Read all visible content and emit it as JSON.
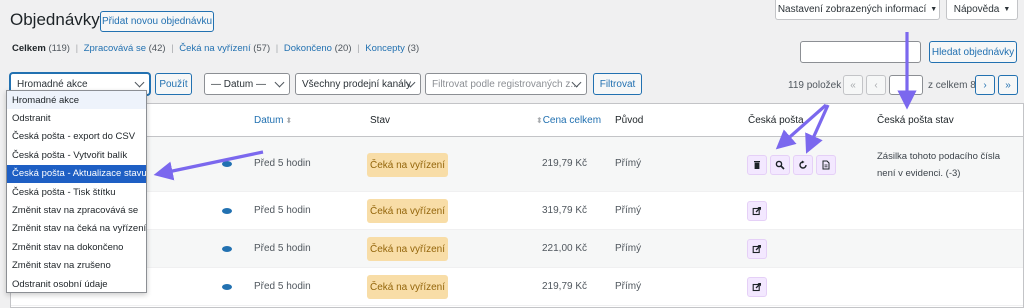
{
  "header": {
    "title": "Objednávky",
    "add_button": "Přidat novou objednávku",
    "screen_options": "Nastavení zobrazených informací",
    "help": "Nápověda"
  },
  "status_filters": [
    {
      "label": "Celkem",
      "count": "(119)"
    },
    {
      "label": "Zpracovává se",
      "count": "(42)"
    },
    {
      "label": "Čeká na vyřízení",
      "count": "(57)"
    },
    {
      "label": "Dokončeno",
      "count": "(20)"
    },
    {
      "label": "Koncepty",
      "count": "(3)"
    }
  ],
  "search": {
    "value": "",
    "button": "Hledat objednávky"
  },
  "toolbar": {
    "bulk_actions": "Hromadné akce",
    "apply": "Použít",
    "date_filter": "— Datum —",
    "channel_filter": "Všechny prodejní kanály",
    "customer_placeholder": "Filtrovat podle registrovaných z...",
    "filter_button": "Filtrovat"
  },
  "pagination": {
    "items": "119 položek",
    "first": "«",
    "prev": "‹",
    "page": "",
    "of_total": "z celkem 8",
    "next": "›",
    "last": "»"
  },
  "dropdown": {
    "items": [
      "Hromadné akce",
      "Odstranit",
      "Česká pošta - export do CSV",
      "Česká pošta - Vytvořit balík",
      "Česká pošta - Aktualizace stavu",
      "Česká pošta - Tisk štítku",
      "Změnit stav na zpracovává se",
      "Změnit stav na čeká na vyřízení",
      "Změnit stav na dokončeno",
      "Změnit stav na zrušeno",
      "Odstranit osobní údaje"
    ],
    "selected_index": 4
  },
  "table": {
    "columns": {
      "date": "Datum",
      "status": "Stav",
      "total": "Cena celkem",
      "origin": "Původ",
      "cp": "Česká pošta",
      "cp_status": "Česká pošta stav"
    },
    "rows": [
      {
        "date": "Před 5 hodin",
        "status": "Čeká na vyřízení",
        "total": "219,79 Kč",
        "origin": "Přímý",
        "cp_status_line1": "Zásilka tohoto podacího čísla",
        "cp_status_line2": "není v evidenci. (-3)"
      },
      {
        "date": "Před 5 hodin",
        "status": "Čeká na vyřízení",
        "total": "319,79 Kč",
        "origin": "Přímý",
        "cp_status_line1": "",
        "cp_status_line2": ""
      },
      {
        "date": "Před 5 hodin",
        "status": "Čeká na vyřízení",
        "total": "221,00 Kč",
        "origin": "Přímý",
        "cp_status_line1": "",
        "cp_status_line2": ""
      },
      {
        "date": "Před 5 hodin",
        "status": "Čeká na vyřízení",
        "total": "219,79 Kč",
        "origin": "Přímý",
        "cp_status_line1": "",
        "cp_status_line2": ""
      }
    ]
  },
  "colors": {
    "accent": "#2271b1",
    "annotation_arrow": "#7b68ee",
    "status_badge_bg": "#f8dda7",
    "status_badge_text": "#94660c",
    "dropdown_selected": "#1e5fc4"
  }
}
